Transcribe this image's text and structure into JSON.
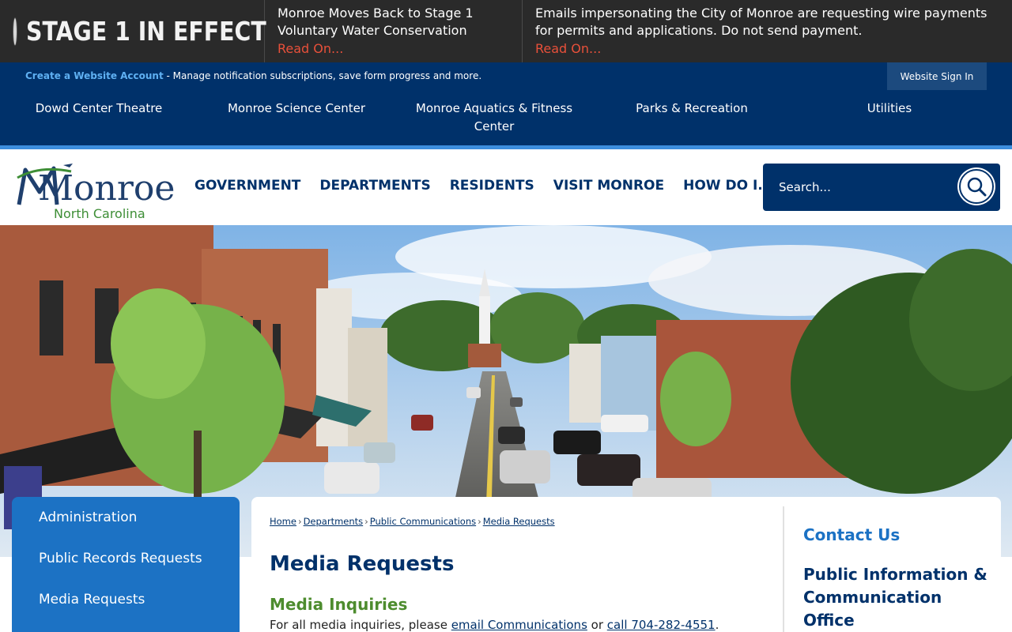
{
  "alert": {
    "stage_label": "STAGE 1 IN EFFECT",
    "items": [
      {
        "text": "Monroe Moves Back to Stage 1 Voluntary Water Conservation",
        "link": "Read On..."
      },
      {
        "text": "Emails impersonating the City of Monroe are requesting wire payments for permits and applications. Do not send payment.",
        "link": "Read On..."
      }
    ]
  },
  "account": {
    "create_link": "Create a Website Account",
    "description": " - Manage notification subscriptions, save form progress and more.",
    "signin_label": "Website Sign In"
  },
  "quick_links": [
    "Dowd Center Theatre",
    "Monroe Science Center",
    "Monroe Aquatics & Fitness Center",
    "Parks & Recreation",
    "Utilities"
  ],
  "logo": {
    "word": "Monroe",
    "sub": "North Carolina"
  },
  "main_nav": [
    "GOVERNMENT",
    "DEPARTMENTS",
    "RESIDENTS",
    "VISIT MONROE",
    "HOW DO I..."
  ],
  "search": {
    "placeholder": "Search..."
  },
  "side_nav": [
    "Administration",
    "Public Records Requests",
    "Media Requests"
  ],
  "breadcrumb": [
    "Home",
    "Departments",
    "Public Communications",
    "Media Requests"
  ],
  "content": {
    "page_title": "Media Requests",
    "section_title": "Media Inquiries",
    "body_prefix": "For all media inquiries, please ",
    "email_link": "email Communications",
    "body_middle": " or ",
    "call_link": "call 704-282-4551",
    "body_suffix": "."
  },
  "contact": {
    "title": "Contact Us",
    "office": "Public Information & Communication Office"
  },
  "colors": {
    "navy": "#00316a",
    "accent_blue": "#1c72c4",
    "alert_red": "#e2231a",
    "green": "#4d8c2e"
  }
}
